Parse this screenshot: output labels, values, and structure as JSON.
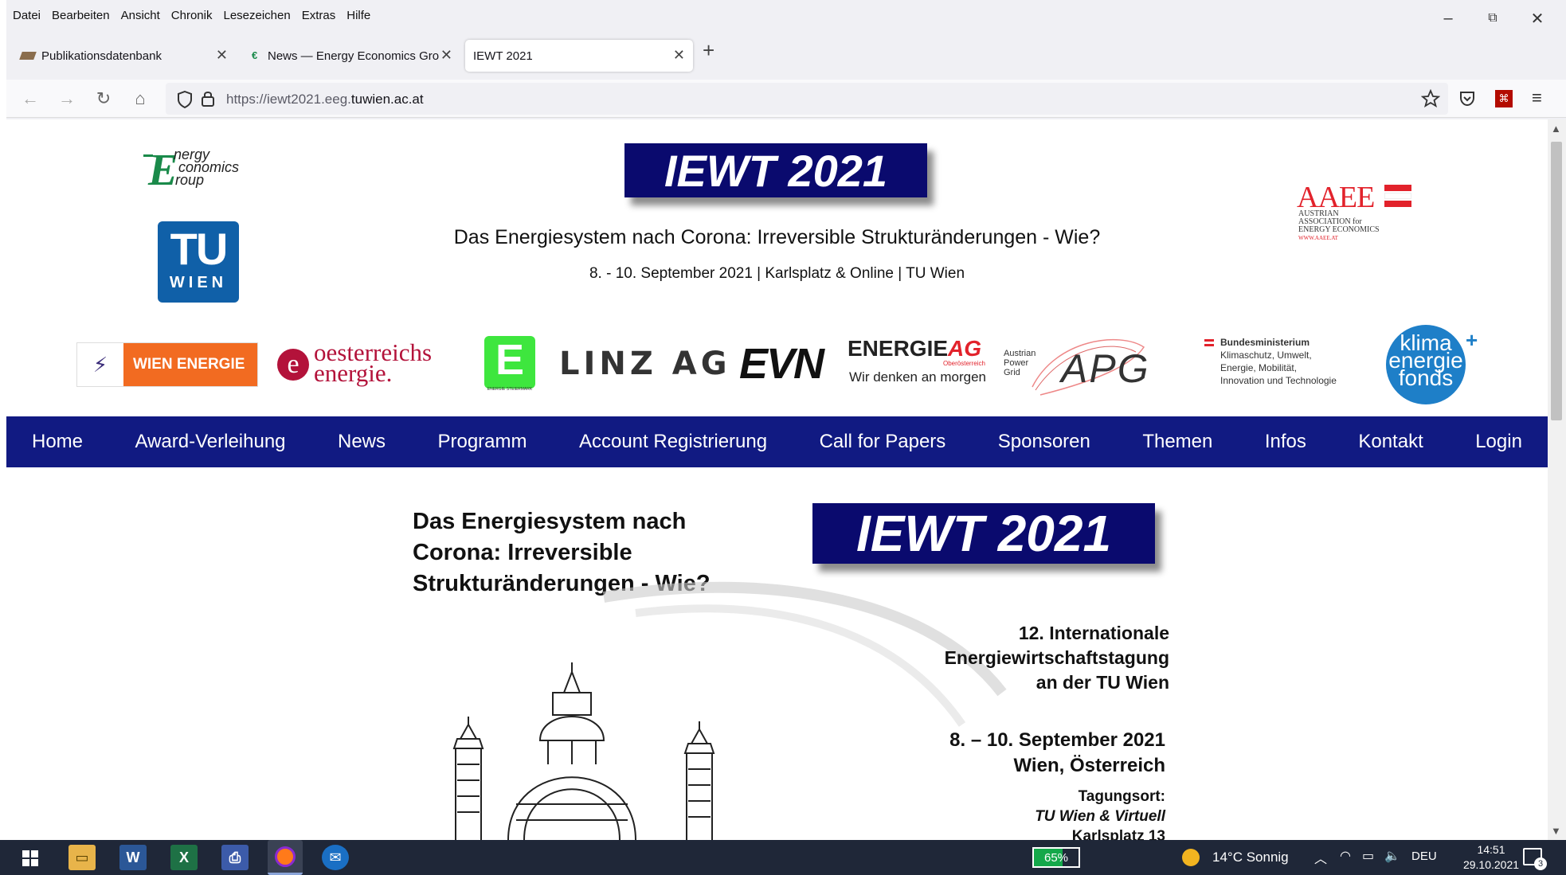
{
  "menu": [
    "Datei",
    "Bearbeiten",
    "Ansicht",
    "Chronik",
    "Lesezeichen",
    "Extras",
    "Hilfe"
  ],
  "window_controls": {
    "minimize": "–",
    "restore": "⧉",
    "close": "✕"
  },
  "tabs": [
    {
      "label": "Publikationsdatenbank",
      "close": "✕"
    },
    {
      "label": "News — Energy Economics Gro",
      "close": "✕"
    },
    {
      "label": "IEWT 2021",
      "close": "✕",
      "active": true
    }
  ],
  "new_tab": "+",
  "nav": {
    "back": "←",
    "forward": "→",
    "reload": "↻",
    "home": "⌂"
  },
  "url": {
    "prefix": "https://iewt2021.eeg.",
    "domain": "tuwien.ac.at"
  },
  "header": {
    "eeg_logo_lines": [
      "nergy",
      "conomics",
      "roup"
    ],
    "tu_logo_top": "TU",
    "tu_logo_bottom": "WIEN",
    "banner": "IEWT 2021",
    "subtitle": "Das Energiesystem nach Corona: Irreversible Strukturänderungen - Wie?",
    "dateline": "8. - 10. September 2021 | Karlsplatz & Online | TU Wien",
    "aaee": {
      "big": "AAEE",
      "lines": [
        "AUSTRIAN",
        "ASSOCIATION for",
        "ENERGY ECONOMICS"
      ],
      "url": "WWW.AAEE.AT"
    }
  },
  "sponsors": {
    "wien_energie": "WIEN ENERGIE",
    "oe_line1": "oesterreichs",
    "oe_line2": "energie.",
    "e_steiermark": "E",
    "e_steiermark_sub": "ENERGIE STEIERMARK",
    "linz": "LINZ AG",
    "evn": "EVN",
    "energie_ag": "ENERGIE",
    "energie_ag_ag": "AG",
    "energie_ag_sub": "Oberösterreich",
    "energie_ag_slogan": "Wir denken an morgen",
    "apg_small": [
      "Austrian",
      "Power",
      "Grid"
    ],
    "apg": "APG",
    "ministry": [
      "Bundesministerium",
      "Klimaschutz, Umwelt,",
      "Energie, Mobilität,",
      "Innovation und Technologie"
    ],
    "klima": [
      "klima",
      "energie",
      "fonds"
    ],
    "klima_plus": "+"
  },
  "topnav": [
    "Home",
    "Award-Verleihung",
    "News",
    "Programm",
    "Account Registrierung",
    "Call for Papers",
    "Sponsoren",
    "Themen",
    "Infos",
    "Kontakt",
    "Login"
  ],
  "poster": {
    "title_lines": [
      "Das Energiesystem nach",
      "Corona: Irreversible",
      "Strukturänderungen - Wie?"
    ],
    "banner": "IEWT 2021",
    "conf_lines": [
      "12. Internationale",
      "Energiewirtschaftstagung",
      "an der TU Wien"
    ],
    "date_lines": [
      "8. – 10. September 2021",
      "Wien, Österreich"
    ],
    "venue_label": "Tagungsort:",
    "venue": "TU Wien & Virtuell",
    "venue_cut": "Karlsplatz 13"
  },
  "taskbar": {
    "battery": "65%",
    "weather": "14°C  Sonnig",
    "lang": "DEU",
    "time": "14:51",
    "date": "29.10.2021",
    "notif": "3"
  },
  "colors": {
    "nav_blue": "#111a82",
    "banner_blue": "#0a0a6e",
    "wien_orange": "#f26b21",
    "aaee_red": "#e2222b",
    "klima_blue": "#1e7fc8"
  }
}
